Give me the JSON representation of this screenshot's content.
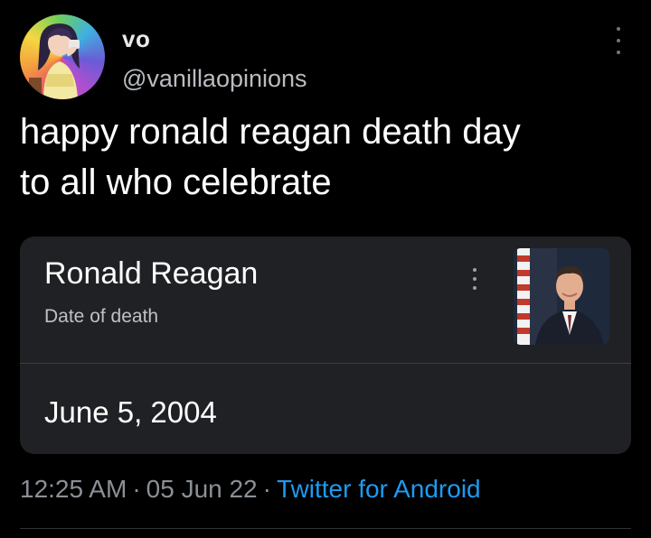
{
  "tweet": {
    "author": {
      "display_name": "vo",
      "handle": "@vanillaopinions",
      "avatar_icon": "anime-avatar-icon"
    },
    "text_line1": "happy ronald reagan death day",
    "text_line2": "to all who celebrate",
    "more_icon": "more-vertical-icon"
  },
  "card": {
    "title": "Ronald Reagan",
    "subtitle": "Date of death",
    "value": "June 5, 2004",
    "more_icon": "more-vertical-icon",
    "image_icon": "portrait-photo-icon"
  },
  "meta": {
    "time": "12:25 AM",
    "separator": "·",
    "date": "05 Jun 22",
    "source": "Twitter for Android"
  },
  "colors": {
    "background": "#000000",
    "card_background": "#202124",
    "link": "#1d9bf0",
    "muted": "#8b9096"
  }
}
